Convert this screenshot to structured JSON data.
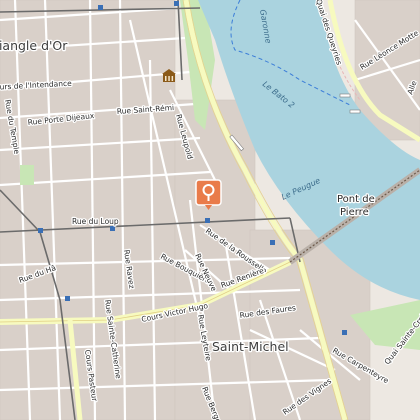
{
  "map": {
    "colors": {
      "river": "#aad3df",
      "land": "#ede8e2",
      "block": "#d9d0c9",
      "park": "#c8e6b5",
      "road_major": "#f7fabf",
      "road_minor": "#ffffff",
      "tram": "#6b6b6b",
      "marker": "#e97b4a"
    },
    "districts": {
      "triangle": "Triangle d'Or",
      "saint_michel": "Saint-Michel"
    },
    "water": {
      "garonne": "Garonne",
      "bato": "Le Bato 2",
      "peugue": "Le Peugue"
    },
    "bridge": {
      "name_line1": "Pont de",
      "name_line2": "Pierre"
    },
    "streets": {
      "intendance": "Cours de l'Intendance",
      "porte_dijeaux": "Rue Porte Dijeaux",
      "saint_remi": "Rue Saint-Rémi",
      "temple": "Rue du Temple",
      "leupold": "Rue Leupold",
      "loup": "Rue du Loup",
      "rousselle": "Rue de la Rousselle",
      "bouquiere": "Rue Bouquière",
      "renière": "Rue Renière",
      "neuve": "Rue Neuve",
      "ravez": "Rue Ravez",
      "ha": "Rue du Hâ",
      "victor_hugo": "Cours Victor Hugo",
      "sainte_catherine": "Rue Sainte-Catherine",
      "pessac": "Cours Pasteur",
      "leyteire": "Rue Leyteire",
      "faures": "Rue des Faures",
      "vignes": "Rue des Vignes",
      "carpenteyre": "Rue Carpenteyre",
      "bergeret": "Rue Bergeret",
      "queyries": "Quai des Queyries",
      "leonce": "Rue Léonce Motte",
      "alle": "Alle",
      "quai_saint_michel": "Quai Sainte-Croix"
    },
    "marker_icon": "map-pin-icon",
    "landmark_icon": "museum-icon"
  }
}
